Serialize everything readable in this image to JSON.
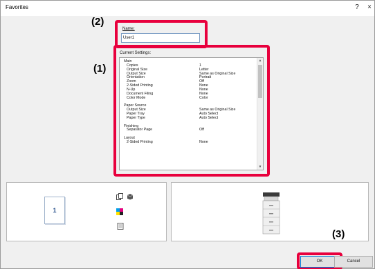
{
  "window": {
    "title": "Favorites",
    "help_label": "?",
    "close_label": "×"
  },
  "callouts": {
    "one": "(1)",
    "two": "(2)",
    "three": "(3)"
  },
  "name_field": {
    "label": "Name:",
    "value": "User1"
  },
  "current_settings": {
    "label": "Current Settings:",
    "rows": [
      {
        "key": "Main",
        "value": "",
        "indent": false
      },
      {
        "key": "Copies",
        "value": "1",
        "indent": true
      },
      {
        "key": "Original Size",
        "value": "Letter",
        "indent": true
      },
      {
        "key": "Output Size",
        "value": "Same as Original Size",
        "indent": true
      },
      {
        "key": "Orientation",
        "value": "Portrait",
        "indent": true
      },
      {
        "key": "Zoom",
        "value": "Off",
        "indent": true
      },
      {
        "key": "2-Sided Printing",
        "value": "None",
        "indent": true
      },
      {
        "key": "N-Up",
        "value": "None",
        "indent": true
      },
      {
        "key": "Document Filing",
        "value": "None",
        "indent": true
      },
      {
        "key": "Color Mode",
        "value": "Color",
        "indent": true
      },
      {
        "key": "",
        "value": "",
        "indent": false
      },
      {
        "key": "Paper Source",
        "value": "",
        "indent": false
      },
      {
        "key": "Output Size",
        "value": "Same as Original Size",
        "indent": true
      },
      {
        "key": "Paper Tray",
        "value": "Auto Select",
        "indent": true
      },
      {
        "key": "Paper Type",
        "value": "Auto Select",
        "indent": true
      },
      {
        "key": "",
        "value": "",
        "indent": false
      },
      {
        "key": "Finishing",
        "value": "",
        "indent": false
      },
      {
        "key": "Separator Page",
        "value": "Off",
        "indent": true
      },
      {
        "key": "",
        "value": "",
        "indent": false
      },
      {
        "key": "Layout",
        "value": "",
        "indent": false
      },
      {
        "key": "2-Sided Printing",
        "value": "None",
        "indent": true
      }
    ]
  },
  "preview": {
    "page_number": "1"
  },
  "buttons": {
    "ok": "OK",
    "cancel": "Cancel"
  },
  "colors": {
    "callout_red": "#e8003d",
    "page_number_blue": "#27508c"
  }
}
